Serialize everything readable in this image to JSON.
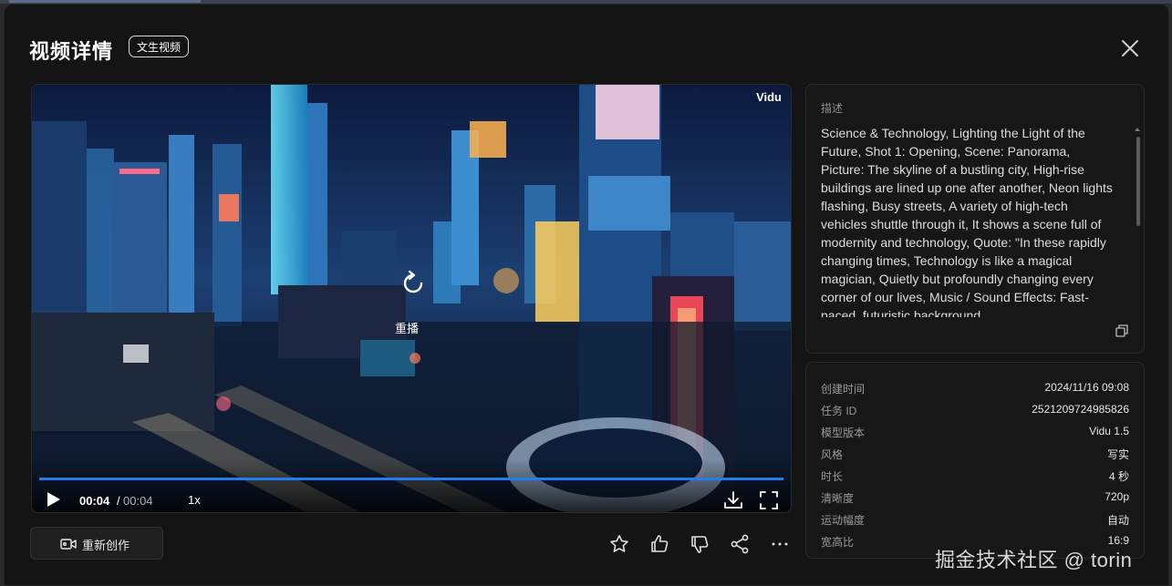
{
  "header": {
    "title": "视频详情",
    "tag": "文生视频"
  },
  "player": {
    "brand": "Vidu",
    "replay_label": "重播",
    "time_current": "00:04",
    "time_separator": "/",
    "time_duration": "00:04",
    "speed": "1x",
    "progress": 1.0,
    "accent_color": "#1f7df0"
  },
  "actions": {
    "recreate_label": "重新创作",
    "icons": [
      "star-icon",
      "thumbs-up-icon",
      "thumbs-down-icon",
      "share-icon",
      "more-icon"
    ]
  },
  "description": {
    "label": "描述",
    "text": "Science & Technology, Lighting the Light of the Future, Shot 1: Opening, Scene: Panorama, Picture: The skyline of a bustling city, High-rise buildings are lined up one after another, Neon lights flashing, Busy streets, A variety of high-tech vehicles shuttle through it, It shows a scene full of modernity and technology, Quote: \"In these rapidly changing times, Technology is like a magical magician, Quietly but profoundly changing every corner of our lives, Music / Sound Effects: Fast-paced, futuristic background"
  },
  "meta": [
    {
      "key": "创建时间",
      "value": "2024/11/16 09:08"
    },
    {
      "key": "任务 ID",
      "value": "2521209724985826"
    },
    {
      "key": "模型版本",
      "value": "Vidu 1.5"
    },
    {
      "key": "风格",
      "value": "写实"
    },
    {
      "key": "时长",
      "value": "4 秒"
    },
    {
      "key": "清晰度",
      "value": "720p"
    },
    {
      "key": "运动幅度",
      "value": "自动"
    },
    {
      "key": "宽高比",
      "value": "16:9"
    }
  ],
  "watermark": "掘金技术社区 @ torin"
}
